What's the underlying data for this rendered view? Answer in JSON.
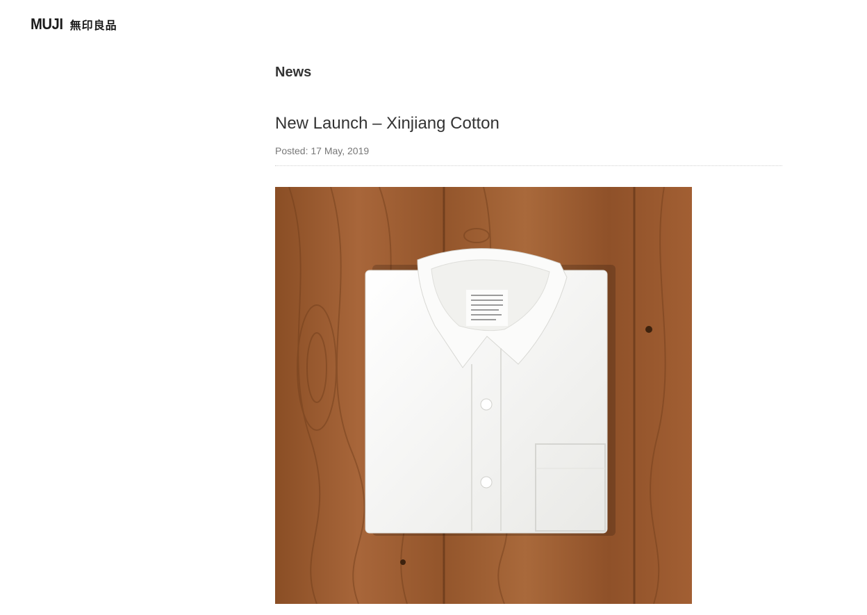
{
  "brand": {
    "latin": "MUJI",
    "kanji": "無印良品"
  },
  "page": {
    "section_title": "News"
  },
  "post": {
    "title": "New Launch – Xinjiang Cotton",
    "posted": "Posted: 17 May, 2019"
  },
  "colors": {
    "text": "#333333",
    "meta": "#777777",
    "wood": "#9a5a2c",
    "shirt": "#f6f6f4"
  }
}
